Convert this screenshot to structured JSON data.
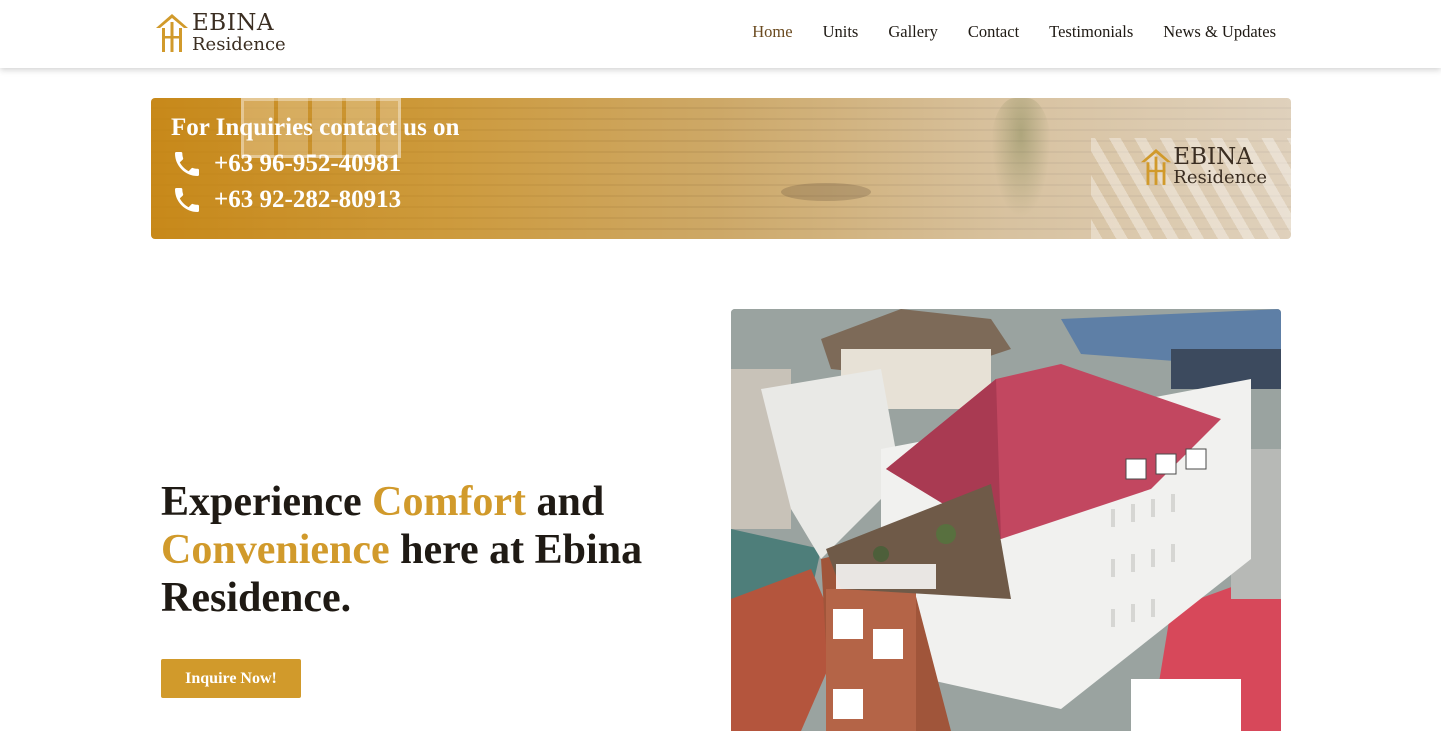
{
  "header": {
    "logo": {
      "line1": "EBINA",
      "line2": "Residence",
      "icon": "ebina-logo-icon",
      "accent": "#d19a2b"
    },
    "nav": [
      {
        "label": "Home",
        "active": true
      },
      {
        "label": "Units",
        "active": false
      },
      {
        "label": "Gallery",
        "active": false
      },
      {
        "label": "Contact",
        "active": false
      },
      {
        "label": "Testimonials",
        "active": false
      },
      {
        "label": "News & Updates",
        "active": false
      }
    ]
  },
  "banner": {
    "title": "For Inquiries contact us on",
    "phones": [
      "+63 96-952-40981",
      "+63 92-282-80913"
    ],
    "phone_icon": "phone-icon",
    "logo": {
      "line1": "EBINA",
      "line2": "Residence"
    }
  },
  "hero": {
    "heading_parts": [
      {
        "text": "Experience ",
        "highlight": false
      },
      {
        "text": "Comfort",
        "highlight": true
      },
      {
        "text": " and ",
        "highlight": false
      },
      {
        "text": "Convenience",
        "highlight": true
      },
      {
        "text": " here at Ebina Residence.",
        "highlight": false
      }
    ],
    "cta_label": "Inquire Now!",
    "highlight_color": "#d19a2b"
  }
}
